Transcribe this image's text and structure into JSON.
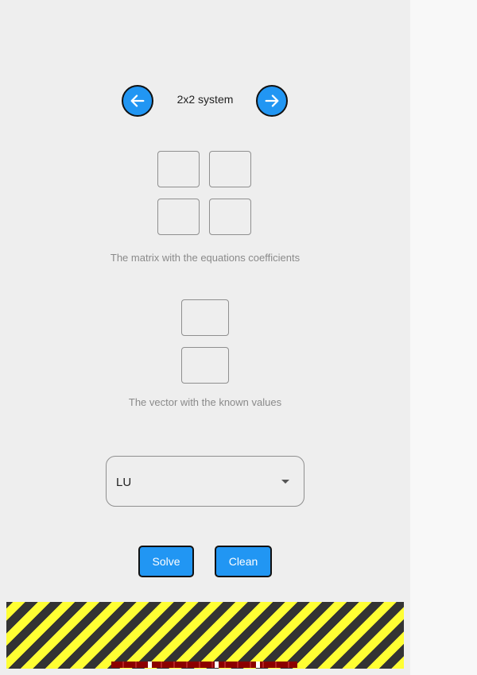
{
  "header": {
    "title": "2x2 system",
    "prev_icon": "arrow-left-icon",
    "next_icon": "arrow-right-icon"
  },
  "matrix": {
    "caption": "The matrix with the equations coefficients",
    "cells": [
      "",
      "",
      "",
      ""
    ]
  },
  "vector": {
    "caption": "The vector with the known values",
    "cells": [
      "",
      ""
    ]
  },
  "method": {
    "selected": "LU"
  },
  "actions": {
    "solve_label": "Solve",
    "clean_label": "Clean"
  },
  "colors": {
    "accent": "#2196f3",
    "panel": "#eeeeee",
    "hazard_yellow": "#ffff33",
    "hazard_dark": "#333333"
  }
}
